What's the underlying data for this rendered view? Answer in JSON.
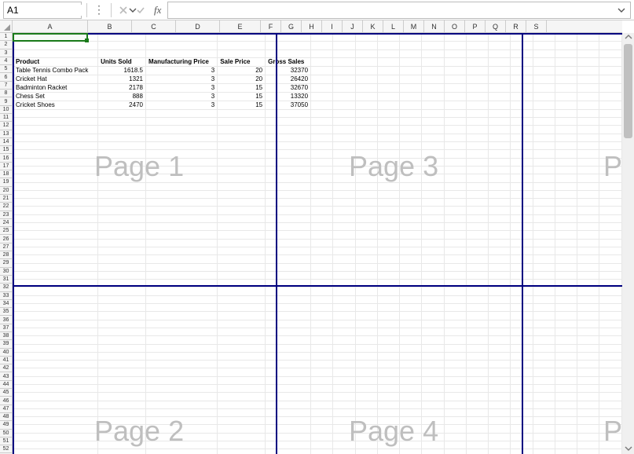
{
  "formula_bar": {
    "cell_ref": "A1",
    "formula": ""
  },
  "columns": [
    "A",
    "B",
    "C",
    "D",
    "E",
    "F",
    "G",
    "H",
    "I",
    "J",
    "K",
    "L",
    "M",
    "N",
    "O",
    "P",
    "Q",
    "R",
    "S"
  ],
  "col_widths": {
    "A": 96,
    "other_wide": 56,
    "E": 52,
    "narrow": 26
  },
  "row_count": 52,
  "active_cell": "A1",
  "page_labels": {
    "p1": "Page 1",
    "p2": "Page 2",
    "p3": "Page 3",
    "p4": "Page 4",
    "p5a": "P",
    "p5b": "P"
  },
  "headers": {
    "product": "Product",
    "units_sold": "Units Sold",
    "mfg_price": "Manufacturing Price",
    "sale_price": "Sale Price",
    "gross_sales": "Gross Sales"
  },
  "rows": [
    {
      "product": "Table Tennis Combo Pack",
      "units_sold": "1618.5",
      "mfg_price": "3",
      "sale_price": "20",
      "gross_sales": "32370"
    },
    {
      "product": "Cricket Hat",
      "units_sold": "1321",
      "mfg_price": "3",
      "sale_price": "20",
      "gross_sales": "26420"
    },
    {
      "product": "Badminton Racket",
      "units_sold": "2178",
      "mfg_price": "3",
      "sale_price": "15",
      "gross_sales": "32670"
    },
    {
      "product": "Chess Set",
      "units_sold": "888",
      "mfg_price": "3",
      "sale_price": "15",
      "gross_sales": "13320"
    },
    {
      "product": "Cricket Shoes",
      "units_sold": "2470",
      "mfg_price": "3",
      "sale_price": "15",
      "gross_sales": "37050"
    }
  ]
}
